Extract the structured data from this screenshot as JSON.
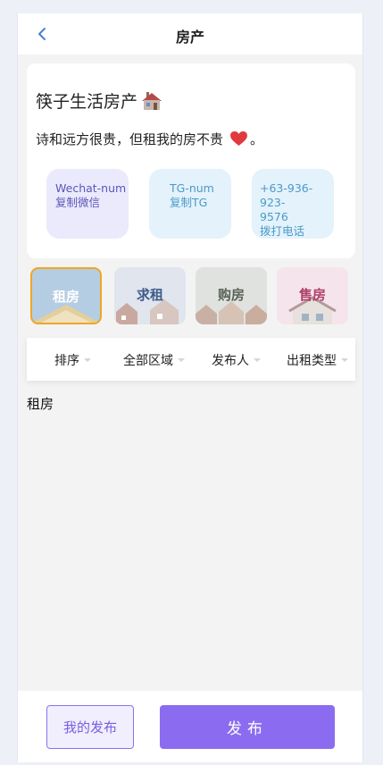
{
  "navbar": {
    "title": "房产",
    "back_icon": "chevron-left-icon"
  },
  "intro": {
    "brand": "筷子生活房产",
    "brand_icon": "house-icon",
    "slogan": "诗和远方很贵，但租我的房不贵",
    "slogan_icon": "heart-icon",
    "slogan_end": "。"
  },
  "contacts": [
    {
      "line1": "Wechat-num",
      "line2": "复制微信"
    },
    {
      "line1": "TG-num",
      "line2": "复制TG"
    },
    {
      "line1": "+63-936-923-",
      "line2": "9576",
      "line3": "拨打电话"
    }
  ],
  "categories": [
    {
      "label": "租房",
      "selected": true
    },
    {
      "label": "求租",
      "selected": false
    },
    {
      "label": "购房",
      "selected": false
    },
    {
      "label": "售房",
      "selected": false
    }
  ],
  "filters": [
    "排序",
    "全部区域",
    "发布人",
    "出租类型"
  ],
  "list_title": "租房",
  "footer": {
    "my_posts": "我的发布",
    "post": "发布"
  },
  "colors": {
    "accent": "#8b6cf0",
    "selected_border": "#f0a526",
    "heart": "#e0393e"
  }
}
